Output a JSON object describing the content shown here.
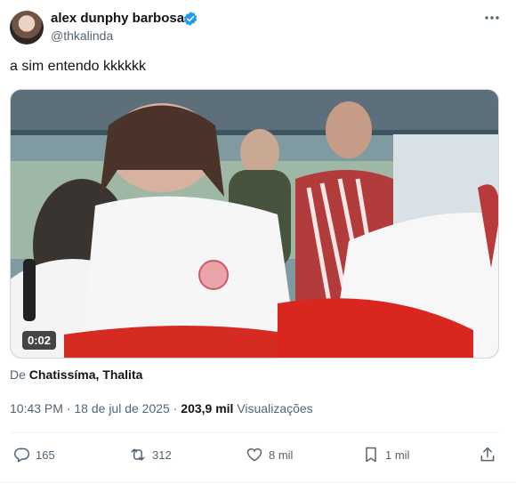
{
  "author": {
    "name": "alex dunphy barbosa",
    "handle": "@thkalinda",
    "verified": true
  },
  "tweet_text": "a sim entendo kkkkkk",
  "video": {
    "duration": "0:02"
  },
  "attribution": {
    "prefix": "De",
    "source": "Chatissíma, Thalita"
  },
  "meta": {
    "time": "10:43 PM",
    "separator": "·",
    "date": "18 de jul de 2025",
    "views_count": "203,9 mil",
    "views_label": "Visualizações"
  },
  "actions": {
    "replies": "165",
    "reposts": "312",
    "likes": "8 mil",
    "bookmarks": "1 mil"
  },
  "colors": {
    "verified": "#1d9bf0",
    "secondary_text": "#536471",
    "primary_text": "#0f1419"
  },
  "icons": [
    "more-icon",
    "verified-icon",
    "reply-icon",
    "repost-icon",
    "like-icon",
    "bookmark-icon",
    "share-icon"
  ]
}
